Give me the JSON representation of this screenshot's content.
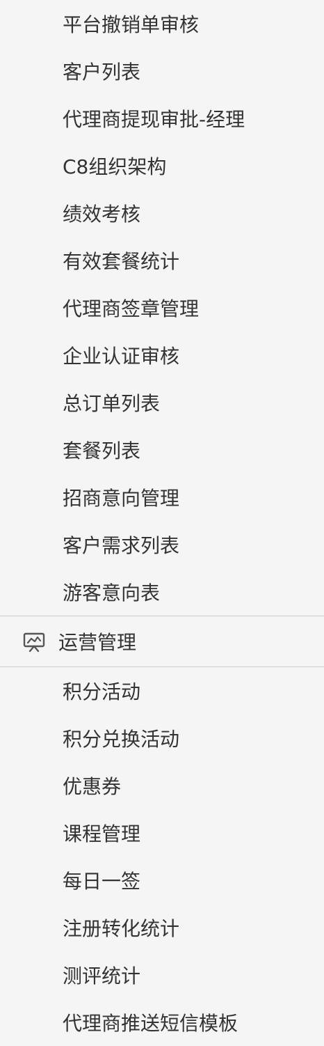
{
  "menu": {
    "top_items": [
      {
        "label": "平台撤销单审核"
      },
      {
        "label": "客户列表"
      },
      {
        "label": "代理商提现审批-经理"
      },
      {
        "label": "C8组织架构"
      },
      {
        "label": "绩效考核"
      },
      {
        "label": "有效套餐统计"
      },
      {
        "label": "代理商签章管理"
      },
      {
        "label": "企业认证审核"
      },
      {
        "label": "总订单列表"
      },
      {
        "label": "套餐列表"
      },
      {
        "label": "招商意向管理"
      },
      {
        "label": "客户需求列表"
      },
      {
        "label": "游客意向表"
      }
    ],
    "operations_group": {
      "icon": "presentation-board-icon",
      "title": "运营管理",
      "items": [
        {
          "label": "积分活动"
        },
        {
          "label": "积分兑换活动"
        },
        {
          "label": "优惠券"
        },
        {
          "label": "课程管理"
        },
        {
          "label": "每日一签"
        },
        {
          "label": "注册转化统计"
        },
        {
          "label": "测评统计"
        },
        {
          "label": "代理商推送短信模板"
        }
      ]
    }
  }
}
